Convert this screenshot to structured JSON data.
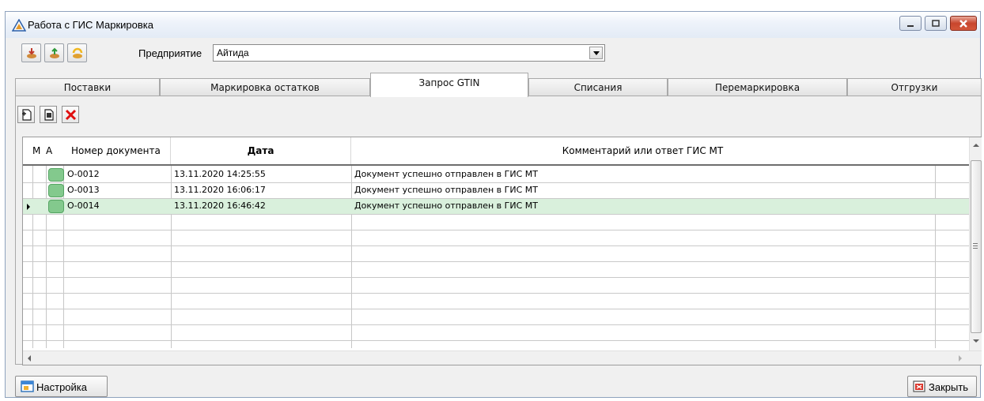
{
  "window": {
    "title": "Работа с ГИС Маркировка",
    "controls": {
      "minimize_icon": "minimize-icon",
      "maximize_icon": "maximize-icon",
      "close_icon": "close-icon"
    }
  },
  "toolbar": {
    "enterprise_label": "Предприятие",
    "enterprise_value": "Айтида"
  },
  "tabs": [
    {
      "label": "Поставки"
    },
    {
      "label": "Маркировка остатков"
    },
    {
      "label": "Запрос GTIN",
      "active": true
    },
    {
      "label": "Списания"
    },
    {
      "label": "Перемаркировка"
    },
    {
      "label": "Отгрузки"
    }
  ],
  "grid": {
    "columns": [
      "М",
      "А",
      "Номер документа",
      "Дата",
      "Комментарий или ответ ГИС МТ"
    ],
    "rows": [
      {
        "number": "О-0012",
        "date": "13.11.2020 14:25:55",
        "comment": "Документ успешно отправлен в ГИС МТ"
      },
      {
        "number": "О-0013",
        "date": "13.11.2020 16:06:17",
        "comment": "Документ успешно отправлен в ГИС МТ"
      },
      {
        "number": "О-0014",
        "date": "13.11.2020 16:46:42",
        "comment": "Документ успешно отправлен в ГИС МТ",
        "selected": true
      }
    ]
  },
  "footer": {
    "settings_label": "Настройка",
    "close_label": "Закрыть"
  },
  "colors": {
    "status_ok": "#83c98d",
    "selected_row": "#d9f0dc",
    "delete_red": "#e01010"
  }
}
